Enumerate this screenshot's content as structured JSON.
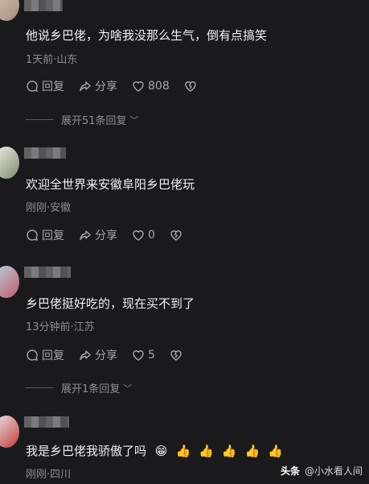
{
  "comments": [
    {
      "text": "他说乡巴佬，为啥我没那么生气，倒有点搞笑",
      "meta": "1天前·山东",
      "reply_label": "回复",
      "share_label": "分享",
      "likes": "808",
      "expand_label": "展开51条回复"
    },
    {
      "text": "欢迎全世界来安徽阜阳乡巴佬玩",
      "meta": "刚刚·安徽",
      "reply_label": "回复",
      "share_label": "分享",
      "likes": "0"
    },
    {
      "text": "乡巴佬挺好吃的，现在买不到了",
      "meta": "13分钟前·江苏",
      "reply_label": "回复",
      "share_label": "分享",
      "likes": "5",
      "expand_label": "展开1条回复"
    },
    {
      "text": "我是乡巴佬我骄傲了吗",
      "emojis": [
        "😁",
        "👍",
        "👍",
        "👍",
        "👍",
        "👍"
      ],
      "meta": "刚刚·四川"
    }
  ],
  "watermark": {
    "brand": "头条",
    "handle": "@小水看人间"
  },
  "colors": {
    "background": "#1a1a1c",
    "text": "#f0f0f2",
    "meta": "#8e8e93"
  }
}
